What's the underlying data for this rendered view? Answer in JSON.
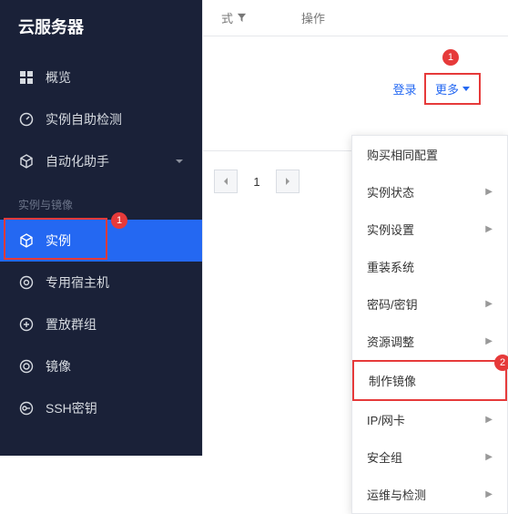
{
  "sidebar": {
    "title": "云服务器",
    "items": [
      {
        "label": "概览",
        "icon": "grid-icon"
      },
      {
        "label": "实例自助检测",
        "icon": "gauge-icon"
      },
      {
        "label": "自动化助手",
        "icon": "cube-icon",
        "expandable": true
      }
    ],
    "section_title": "实例与镜像",
    "section_items": [
      {
        "label": "实例",
        "icon": "cube-icon",
        "selected": true
      },
      {
        "label": "专用宿主机",
        "icon": "host-icon"
      },
      {
        "label": "置放群组",
        "icon": "group-icon"
      },
      {
        "label": "镜像",
        "icon": "ring-icon"
      },
      {
        "label": "SSH密钥",
        "icon": "key-icon"
      }
    ]
  },
  "header": {
    "col1": "式",
    "col2": "操作"
  },
  "actions": {
    "login": "登录",
    "more": "更多"
  },
  "pagination": {
    "current": "1"
  },
  "dropdown": [
    {
      "label": "购买相同配置",
      "sub": false
    },
    {
      "label": "实例状态",
      "sub": true
    },
    {
      "label": "实例设置",
      "sub": true
    },
    {
      "label": "重装系统",
      "sub": false
    },
    {
      "label": "密码/密钥",
      "sub": true
    },
    {
      "label": "资源调整",
      "sub": true
    },
    {
      "label": "制作镜像",
      "sub": false,
      "highlighted": true
    },
    {
      "label": "IP/网卡",
      "sub": true
    },
    {
      "label": "安全组",
      "sub": true
    },
    {
      "label": "运维与检测",
      "sub": true
    }
  ],
  "badges": {
    "one": "1",
    "two": "2"
  }
}
